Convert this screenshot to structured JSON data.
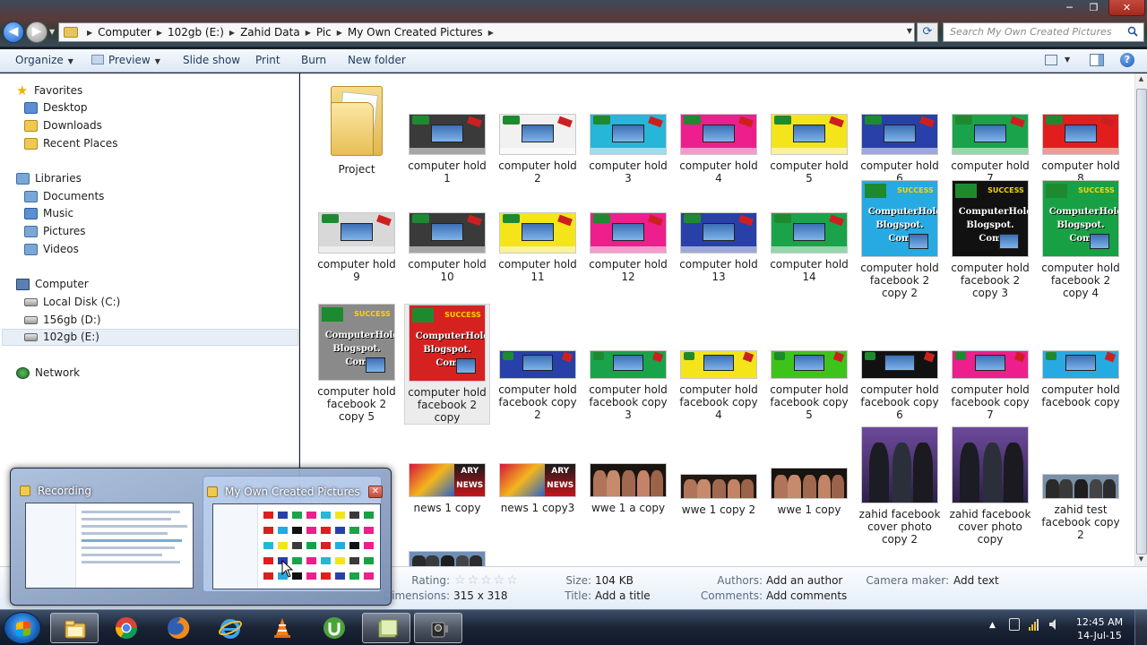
{
  "window": {
    "minimize": "─",
    "maximize": "❐",
    "close": "✕"
  },
  "address": {
    "crumbs": [
      "Computer",
      "102gb (E:)",
      "Zahid Data",
      "Pic",
      "My Own Created Pictures"
    ],
    "search_placeholder": "Search My Own Created Pictures"
  },
  "toolbar": {
    "organize": "Organize",
    "preview": "Preview",
    "slideshow": "Slide show",
    "print": "Print",
    "burn": "Burn",
    "new_folder": "New folder"
  },
  "nav": {
    "favorites": "Favorites",
    "desktop": "Desktop",
    "downloads": "Downloads",
    "recent": "Recent Places",
    "libraries": "Libraries",
    "documents": "Documents",
    "music": "Music",
    "pictures": "Pictures",
    "videos": "Videos",
    "computer": "Computer",
    "local_c": "Local Disk (C:)",
    "drive_d": "156gb (D:)",
    "drive_e": "102gb (E:)",
    "network": "Network"
  },
  "items": {
    "r1": [
      "Project",
      "computer hold 1",
      "computer hold 2",
      "computer hold 3",
      "computer hold 4",
      "computer hold 5",
      "computer hold 6",
      "computer hold 7",
      "computer hold 8"
    ],
    "r2": [
      "computer hold 9",
      "computer hold 10",
      "computer hold 11",
      "computer hold 12",
      "computer hold 13",
      "computer hold 14",
      "computer hold facebook 2 copy 2",
      "computer hold facebook 2 copy 3",
      "computer hold facebook 2 copy 4"
    ],
    "r3": [
      "computer hold facebook 2 copy 5",
      "computer hold facebook 2 copy",
      "computer hold facebook copy 2",
      "computer hold facebook copy 3",
      "computer hold facebook copy 4",
      "computer hold facebook copy 5",
      "computer hold facebook copy 6",
      "computer hold facebook copy 7",
      "computer hold facebook copy"
    ],
    "r4": [
      "news 1 copy",
      "news 1 copy3",
      "wwe 1 a copy",
      "wwe 1 copy 2",
      "wwe 1 copy",
      "zahid facebook cover photo copy 2",
      "zahid facebook cover photo copy",
      "zahid test facebook copy 2"
    ],
    "news_badge": "ARY",
    "news_badge2": "NEWS",
    "sq_text": "ComputerHold. Blogspot. Com",
    "sq_success": "SUCCESS"
  },
  "details": {
    "rating_label": "Rating:",
    "dimensions_label": "Dimensions:",
    "dimensions_value": "315 x 318",
    "size_label": "Size:",
    "size_value": "104 KB",
    "title_label": "Title:",
    "title_value": "Add a title",
    "authors_label": "Authors:",
    "authors_value": "Add an author",
    "comments_label": "Comments:",
    "comments_value": "Add comments",
    "camera_label": "Camera maker:",
    "camera_value": "Add text"
  },
  "popup": {
    "preview1_title": "Recording",
    "preview2_title": "My Own Created Pictures"
  },
  "clock": {
    "time": "12:45 AM",
    "date": "14-Jul-15"
  },
  "colors": {
    "r1": [
      "#3a3a3a",
      "#f1f1f1",
      "#27b6d8",
      "#ec1f8c",
      "#f3e51a",
      "#2840a8",
      "#1aa34a",
      "#e21d1d"
    ],
    "r2": [
      "#d8d8d8",
      "#3a3a3a",
      "#f3e51a",
      "#ec1f8c",
      "#2840a8",
      "#1aa34a",
      "#27a9e1",
      "#111111",
      "#18a045"
    ],
    "r3": [
      "#8a8a8a",
      "#d62121",
      "#2840a8",
      "#1aa34a",
      "#f3e51a",
      "#3ec31b",
      "#111111",
      "#ec1f8c",
      "#27a9e1"
    ]
  }
}
